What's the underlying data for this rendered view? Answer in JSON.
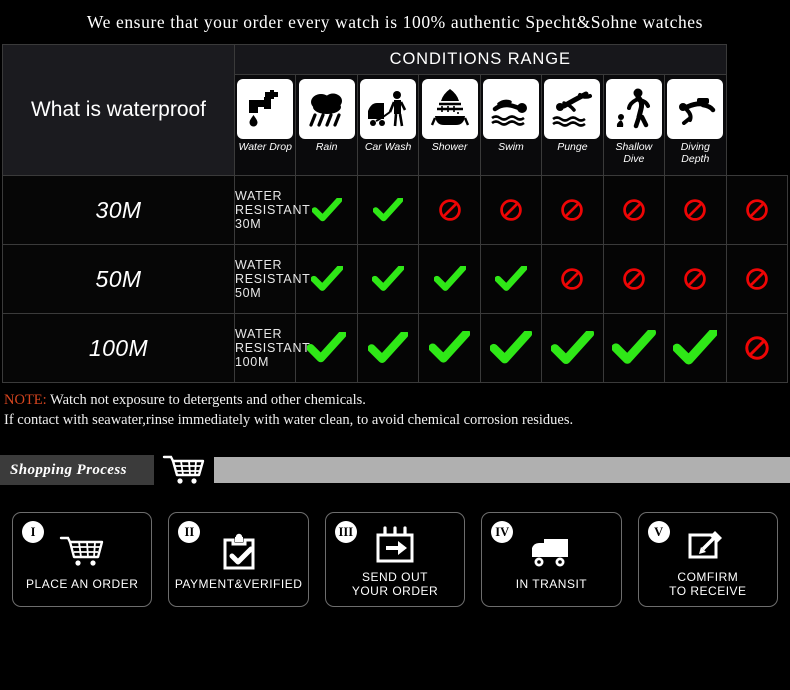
{
  "banner": {
    "text": "We ensure that your order every watch is 100% authentic Specht&Sohne watches"
  },
  "table": {
    "title": "What is waterproof",
    "conditions_header": "CONDITIONS RANGE",
    "columns": [
      {
        "label": "Water Drop",
        "icon": "faucet-drop-icon"
      },
      {
        "label": "Rain",
        "icon": "rain-cloud-icon"
      },
      {
        "label": "Car Wash",
        "icon": "car-wash-icon"
      },
      {
        "label": "Shower",
        "icon": "shower-icon"
      },
      {
        "label": "Swim",
        "icon": "swimmer-icon"
      },
      {
        "label": "Punge",
        "icon": "plunge-dive-icon"
      },
      {
        "label": "Shallow Dive",
        "icon": "shallow-dive-icon"
      },
      {
        "label": "Diving Depth",
        "icon": "scuba-diver-icon"
      }
    ],
    "rows": [
      {
        "depth": "30M",
        "description": "WATER RESISTANT  30M",
        "marks": [
          "check",
          "check",
          "no",
          "no",
          "no",
          "no",
          "no",
          "no"
        ]
      },
      {
        "depth": "50M",
        "description": "WATER RESISTANT 50M",
        "marks": [
          "check",
          "check",
          "check",
          "check",
          "no",
          "no",
          "no",
          "no"
        ]
      },
      {
        "depth": "100M",
        "description": "WATER RESISTANT  100M",
        "marks": [
          "check",
          "check",
          "check",
          "check",
          "check",
          "check",
          "check",
          "no"
        ]
      }
    ]
  },
  "note": {
    "keyword": "NOTE:",
    "line1": " Watch not exposure to detergents and other chemicals.",
    "line2": "If contact with seawater,rinse immediately with water clean, to avoid chemical corrosion residues."
  },
  "process": {
    "tag": "Shopping Process",
    "cart_icon": "shopping-cart-icon",
    "steps": [
      {
        "numeral": "I",
        "label": "PLACE AN ORDER",
        "icon": "shopping-cart-icon"
      },
      {
        "numeral": "II",
        "label": "PAYMENT&VERIFIED",
        "icon": "clipboard-check-icon"
      },
      {
        "numeral": "III",
        "label": "SEND OUT\nYOUR ORDER",
        "icon": "package-outbound-icon"
      },
      {
        "numeral": "IV",
        "label": "IN TRANSIT",
        "icon": "delivery-truck-icon"
      },
      {
        "numeral": "V",
        "label": "COMFIRM\nTO RECEIVE",
        "icon": "sign-document-icon"
      }
    ]
  },
  "colors": {
    "check": "#2fe817",
    "prohibited": "#ee0505",
    "note_keyword": "#d6451f",
    "process_tag_bg": "#3b3b3b",
    "process_bar": "#b0b0b0"
  }
}
